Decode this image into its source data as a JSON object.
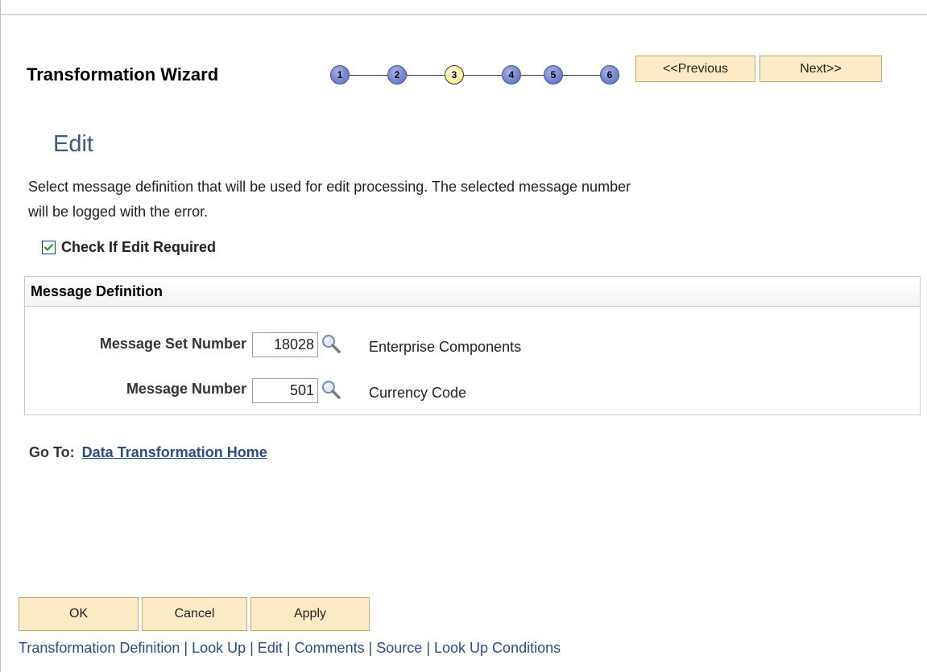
{
  "wizard": {
    "title": "Transformation Wizard",
    "steps": [
      "1",
      "2",
      "3",
      "4",
      "5",
      "6"
    ],
    "current_step": "3",
    "prev_label": "<<Previous",
    "next_label": "Next>>"
  },
  "section": {
    "title": "Edit",
    "instructions": "Select message definition that will be used for edit processing. The selected message number will be logged with the error."
  },
  "edit_required": {
    "label": "Check If Edit Required",
    "checked": true
  },
  "message_definition": {
    "header": "Message Definition",
    "fields": [
      {
        "label": "Message Set Number",
        "value": "18028",
        "description": "Enterprise Components"
      },
      {
        "label": "Message Number",
        "value": "501",
        "description": "Currency Code"
      }
    ]
  },
  "goto": {
    "label": "Go To:",
    "link": "Data Transformation Home"
  },
  "actions": {
    "ok": "OK",
    "cancel": "Cancel",
    "apply": "Apply"
  },
  "footer_links": [
    "Transformation Definition",
    "Look Up",
    "Edit",
    "Comments",
    "Source",
    "Look Up Conditions"
  ],
  "footer_separator": "|",
  "colors": {
    "button_bg": "#fcebc4",
    "link": "#2b4d86",
    "section_title": "#3b5a86",
    "step_active": "#fff2a8",
    "step_inactive": "#7f8dd4"
  }
}
